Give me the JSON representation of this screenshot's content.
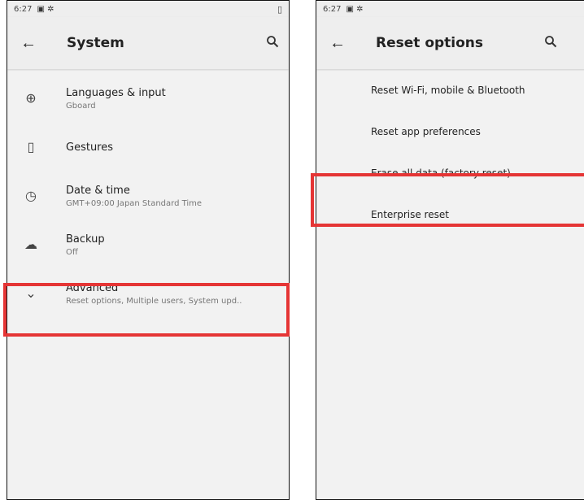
{
  "left_screen": {
    "status_time": "6:27",
    "title": "System",
    "items": [
      {
        "primary": "Languages & input",
        "secondary": "Gboard",
        "icon": "globe-icon",
        "glyph": "⊕"
      },
      {
        "primary": "Gestures",
        "secondary": "",
        "icon": "gesture-phone-icon",
        "glyph": "▯"
      },
      {
        "primary": "Date & time",
        "secondary": "GMT+09:00 Japan Standard Time",
        "icon": "clock-icon",
        "glyph": "◷"
      },
      {
        "primary": "Backup",
        "secondary": "Off",
        "icon": "cloud-upload-icon",
        "glyph": "☁"
      },
      {
        "primary": "Advanced",
        "secondary": "Reset options, Multiple users, System upd..",
        "icon": "chevron-down-icon",
        "glyph": "⌄"
      }
    ]
  },
  "right_screen": {
    "status_time": "6:27",
    "title": "Reset options",
    "items": [
      {
        "label": "Reset Wi-Fi, mobile & Bluetooth"
      },
      {
        "label": "Reset app preferences"
      },
      {
        "label": "Erase all data (factory reset)"
      },
      {
        "label": "Enterprise reset"
      }
    ]
  },
  "glyphs": {
    "back": "←",
    "search": "🔍",
    "battery": "▯",
    "status_icons": "▣ ✲"
  },
  "colors": {
    "highlight": "#e53535",
    "toolbar_bg": "#eeeeee",
    "screen_bg": "#f2f2f2"
  }
}
